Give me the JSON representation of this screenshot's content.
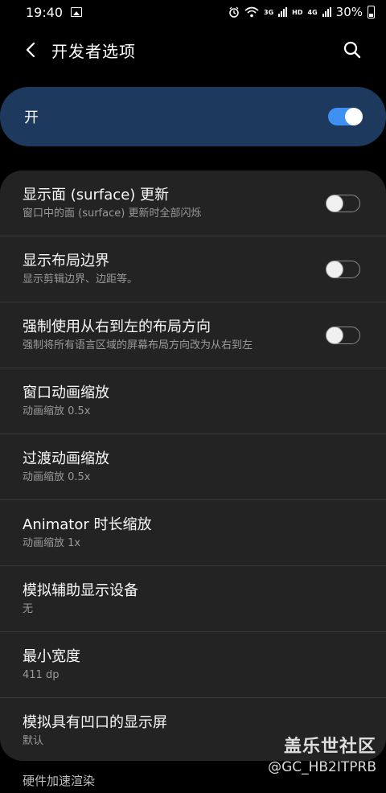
{
  "status_bar": {
    "time": "19:40",
    "battery": "30%",
    "net_3g": "3G",
    "net_hd": "HD",
    "net_4g": "4G"
  },
  "app_bar": {
    "title": "开发者选项"
  },
  "master_switch": {
    "label": "开",
    "on": true
  },
  "settings": [
    {
      "title": "显示面 (surface) 更新",
      "summary": "窗口中的面 (surface) 更新时全部闪烁",
      "toggle": "off"
    },
    {
      "title": "显示布局边界",
      "summary": "显示剪辑边界、边距等。",
      "toggle": "off"
    },
    {
      "title": "强制使用从右到左的布局方向",
      "summary": "强制将所有语言区域的屏幕布局方向改为从右到左",
      "toggle": "off"
    },
    {
      "title": "窗口动画缩放",
      "summary": "动画缩放 0.5x"
    },
    {
      "title": "过渡动画缩放",
      "summary": "动画缩放 0.5x"
    },
    {
      "title": "Animator 时长缩放",
      "summary": "动画缩放 1x"
    },
    {
      "title": "模拟辅助显示设备",
      "summary": "无"
    },
    {
      "title": "最小宽度",
      "summary": "411 dp"
    },
    {
      "title": "模拟具有凹口的显示屏",
      "summary": "默认"
    }
  ],
  "section_header": "硬件加速渲染",
  "watermark": {
    "brand": "盖乐世社区",
    "handle": "@GC_HB2ITPRB"
  },
  "colors": {
    "accent": "#3e91f0",
    "master_bg": "#1d3a5e",
    "card_bg": "#232323"
  }
}
